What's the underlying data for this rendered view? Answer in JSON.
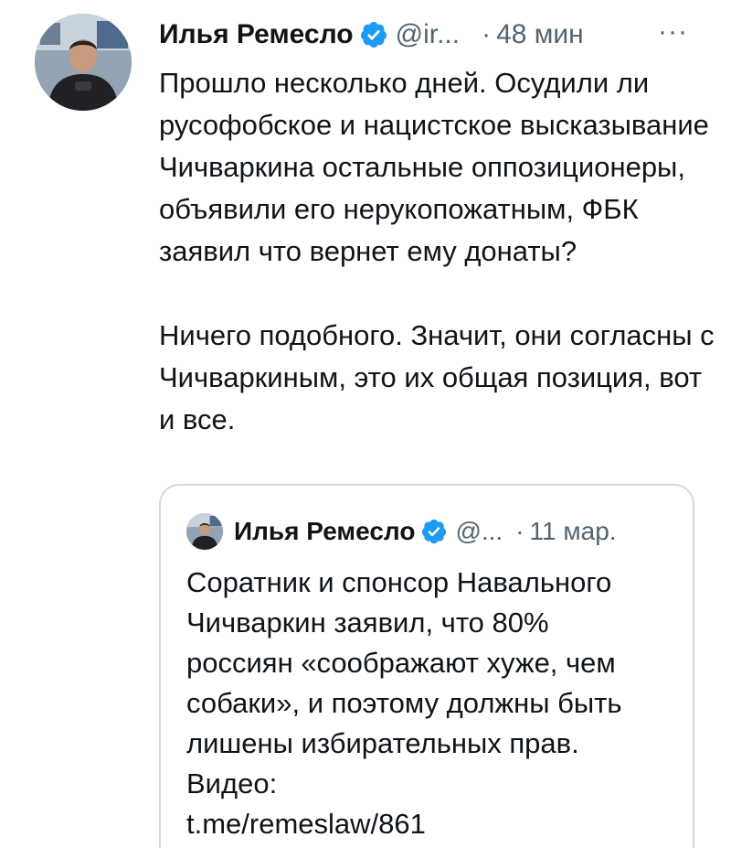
{
  "tweet": {
    "author_name": "Илья Ремесло",
    "handle": "@ir...",
    "separator": "·",
    "time": "48 мин",
    "more_label": "···",
    "paragraphs": [
      "Прошло несколько дней. Осудили ли русофобское и нацистское высказывание Чичваркина остальные оппозиционеры, объявили его нерукопожатным, ФБК заявил что вернет ему донаты?",
      "Ничего подобного. Значит, они согласны с Чичваркиным, это их общая позиция, вот и все."
    ]
  },
  "quoted_tweet": {
    "author_name": "Илья Ремесло",
    "handle": "@...",
    "separator": "·",
    "time": "11 мар.",
    "text_lines": [
      "Соратник и спонсор Навального",
      "Чичваркин заявил, что 80%",
      "россиян «соображают хуже, чем",
      "собаки», и поэтому должны быть",
      "лишены избирательных прав.",
      "Видео:"
    ],
    "link": "t.me/remeslaw/861"
  },
  "colors": {
    "text": "#0f1419",
    "secondary": "#536471",
    "verified": "#1d9bf0",
    "border": "#cfd9de"
  },
  "icons": {
    "verified": "verified-badge-icon",
    "more": "more-dots-icon"
  }
}
